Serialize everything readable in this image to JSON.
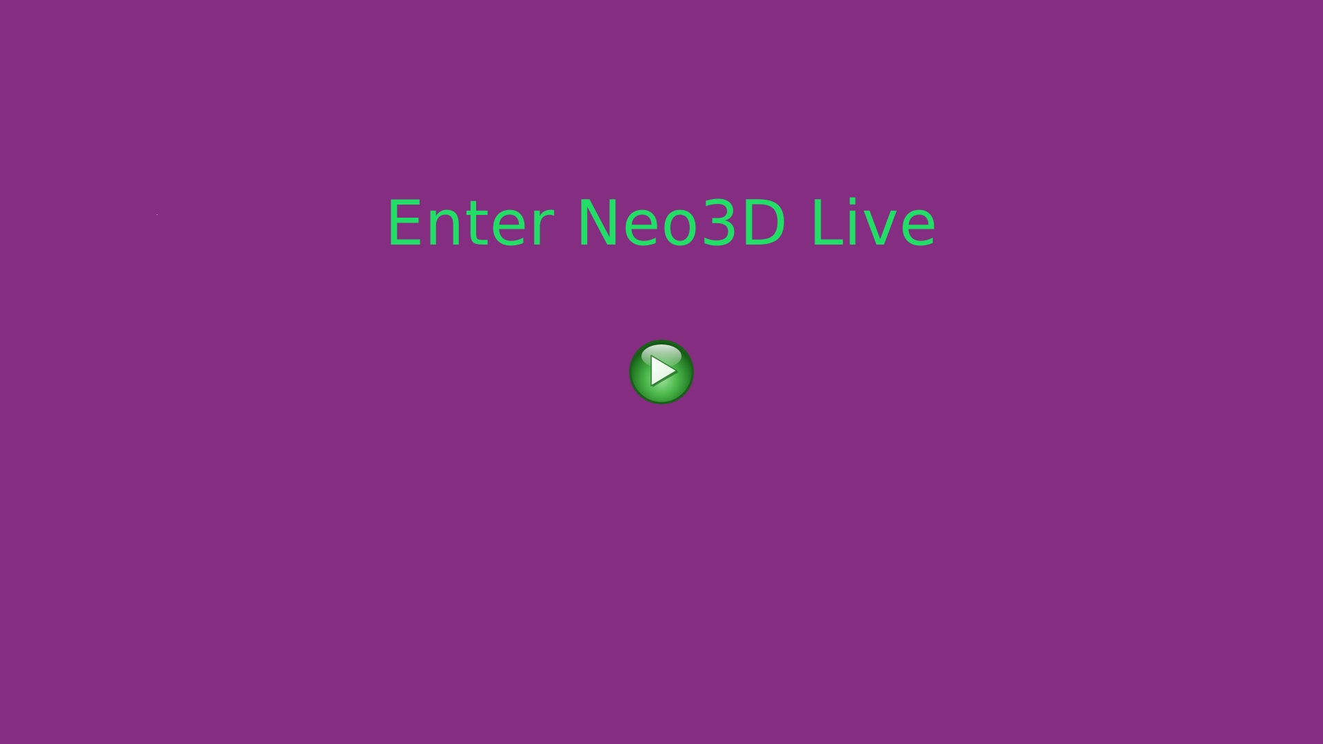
{
  "screen": {
    "title": "Enter Neo3D Live",
    "background_color": "#852d80",
    "title_color": "#22dd66"
  },
  "play_button": {
    "icon": "play-icon",
    "accent_color": "#2e9a2e"
  }
}
